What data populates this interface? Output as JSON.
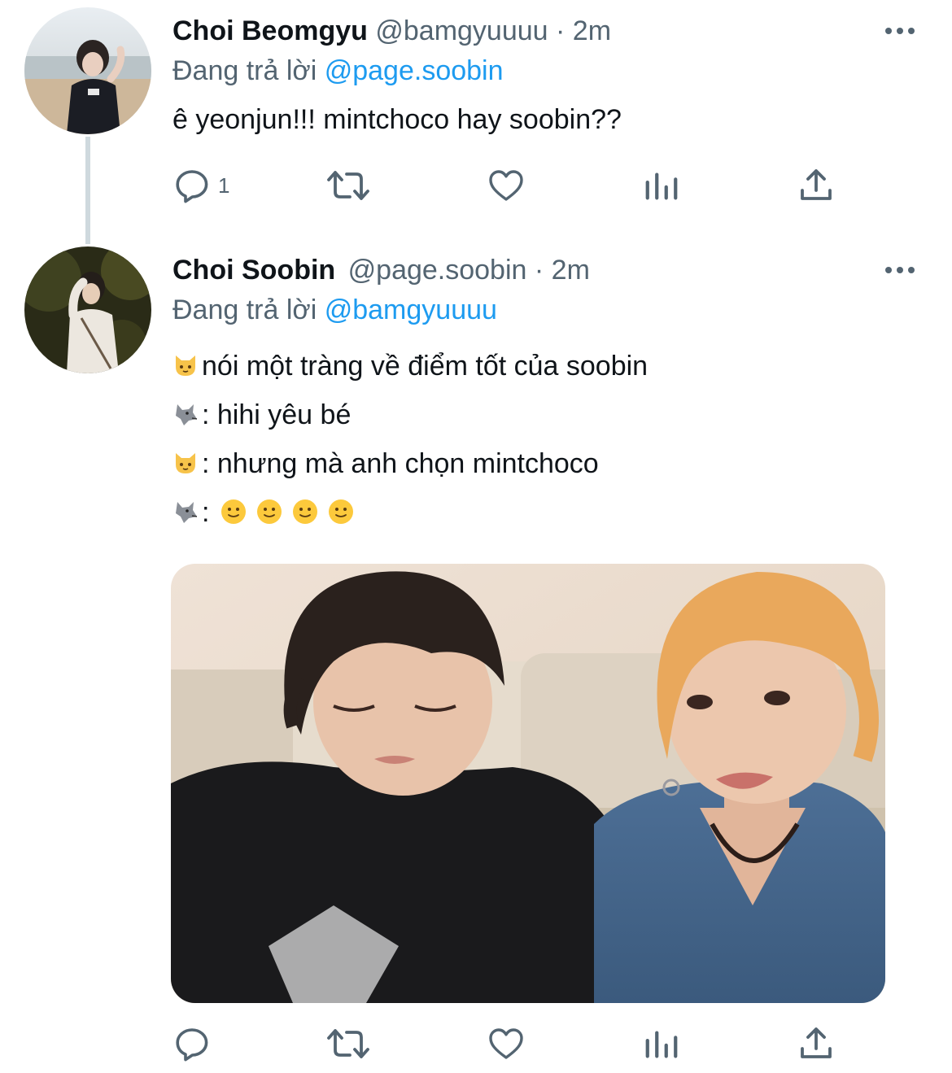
{
  "tweets": [
    {
      "name": "Choi Beomgyu",
      "handle": "@bamgyuuuu",
      "separator": "·",
      "time": "2m",
      "replying_prefix": "Đang trả lời",
      "replying_to": "@page.soobin",
      "text_lines": [
        "ê yeonjun!!! mintchoco hay soobin??"
      ],
      "reply_count": "1"
    },
    {
      "name": "Choi Soobin",
      "handle": "@page.soobin",
      "separator": "·",
      "time": "2m",
      "replying_prefix": "Đang trả lời",
      "replying_to": "@bamgyuuuu",
      "text_lines": [
        "nói một tràng về điểm tốt của soobin",
        ": hihi yêu bé",
        ": nhưng mà anh chọn mintchoco",
        ":"
      ],
      "emoji_lines": [
        "cat-emoji",
        "wolf-emoji",
        "cat-emoji",
        "wolf-emoji"
      ],
      "trailing_emojis": [
        "slight-smile-emoji",
        "slight-smile-emoji",
        "slight-smile-emoji",
        "slight-smile-emoji"
      ],
      "reply_count": ""
    }
  ],
  "icons": {
    "reply": "reply-icon",
    "retweet": "retweet-icon",
    "like": "heart-icon",
    "analytics": "analytics-icon",
    "share": "share-icon",
    "more": "more-icon"
  },
  "colors": {
    "link": "#1d9bf0",
    "secondary": "#536471",
    "thread_line": "#cfd9de"
  }
}
